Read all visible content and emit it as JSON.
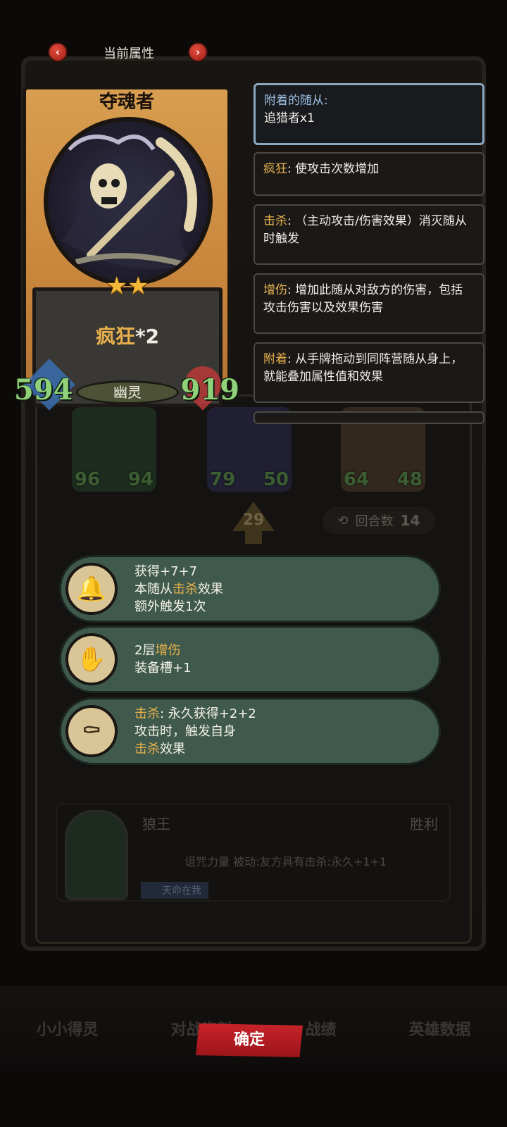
{
  "header": {
    "title": "当前属性",
    "prev_icon": "‹",
    "next_icon": "›"
  },
  "card": {
    "name": "夺魂者",
    "stars": "★★",
    "effect_name": "疯狂",
    "effect_mult": "*2",
    "attack": "594",
    "health": "919",
    "type": "幽灵"
  },
  "tooltips": [
    {
      "keyword": "附着的随从:",
      "text": "追猎者x1"
    },
    {
      "keyword": "疯狂",
      "text": ": 使攻击次数增加"
    },
    {
      "keyword": "击杀",
      "text": ": （主动攻击/伤害效果）消灭随从时触发"
    },
    {
      "keyword": "增伤",
      "text": ": 增加此随从对敌方的伤害，包括攻击伤害以及效果伤害"
    },
    {
      "keyword": "附着",
      "text": ": 从手牌拖动到同阵营随从身上，就能叠加属性值和效果"
    }
  ],
  "equipment": [
    {
      "icon": "bell-icon",
      "lines": [
        {
          "pre": "获得+7+7",
          "kw": "",
          "post": ""
        },
        {
          "pre": "本随从",
          "kw": "击杀",
          "post": "效果"
        },
        {
          "pre": "额外触发1次",
          "kw": "",
          "post": ""
        }
      ]
    },
    {
      "icon": "gauntlet-icon",
      "lines": [
        {
          "pre": "2层",
          "kw": "增伤",
          "post": ""
        },
        {
          "pre": "装备槽+1",
          "kw": "",
          "post": ""
        }
      ]
    },
    {
      "icon": "scythe-icon",
      "lines": [
        {
          "pre": "",
          "kw": "击杀",
          "post": ": 永久获得+2+2"
        },
        {
          "pre": "攻击时，触发自身",
          "kw": "",
          "post": ""
        },
        {
          "pre": "",
          "kw": "击杀",
          "post": "效果"
        }
      ]
    }
  ],
  "background": {
    "rounds_label": "回合数",
    "rounds_value": "14",
    "upgrade_count": "29",
    "minions_top": [
      {
        "atk": "96",
        "hp": "94"
      },
      {
        "atk": "79",
        "hp": "50"
      },
      {
        "atk": "64",
        "hp": "48"
      }
    ],
    "enemy_name": "狼王",
    "enemy_result": "胜利",
    "enemy_passive": "诅咒力量 被动:友方具有击杀:永久+1+1",
    "enemy_tag": "天命在我",
    "tabs": [
      "小小得灵",
      "对战资料",
      "战绩",
      "英雄数据"
    ]
  },
  "confirm_label": "确定"
}
